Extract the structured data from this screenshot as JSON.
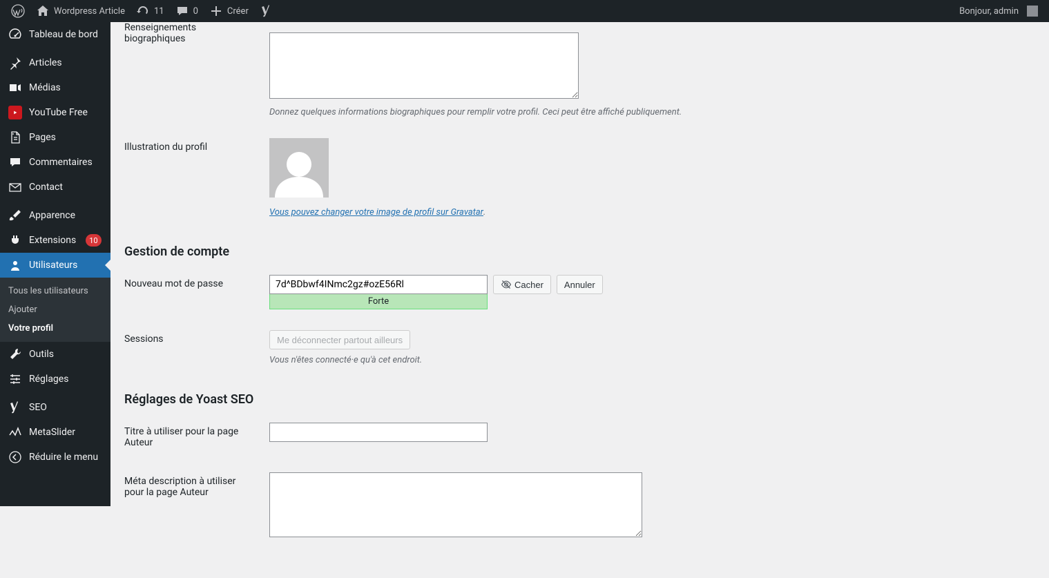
{
  "adminbar": {
    "site_name": "Wordpress Article",
    "updates": "11",
    "comments": "0",
    "new": "Créer",
    "greeting": "Bonjour, admin"
  },
  "menu": {
    "dashboard": "Tableau de bord",
    "posts": "Articles",
    "media": "Médias",
    "youtube": "YouTube Free",
    "pages": "Pages",
    "comments": "Commentaires",
    "contact": "Contact",
    "appearance": "Apparence",
    "plugins": "Extensions",
    "plugins_badge": "10",
    "users": "Utilisateurs",
    "users_sub": {
      "all": "Tous les utilisateurs",
      "add": "Ajouter",
      "profile": "Votre profil"
    },
    "tools": "Outils",
    "settings": "Réglages",
    "seo": "SEO",
    "metaslider": "MetaSlider",
    "collapse": "Réduire le menu"
  },
  "profile": {
    "bio_label": "Renseignements biographiques",
    "bio_desc": "Donnez quelques informations biographiques pour remplir votre profil. Ceci peut être affiché publiquement.",
    "avatar_label": "Illustration du profil",
    "gravatar_link": "Vous pouvez changer votre image de profil sur Gravatar",
    "account_heading": "Gestion de compte",
    "new_pw_label": "Nouveau mot de passe",
    "pw_value": "7d^BDbwf4INmc2gz#ozE56Rl",
    "pw_strength": "Forte",
    "hide_btn": "Cacher",
    "cancel_btn": "Annuler",
    "sessions_label": "Sessions",
    "logout_elsewhere": "Me déconnecter partout ailleurs",
    "sessions_desc": "Vous n'êtes connecté·e qu'à cet endroit.",
    "yoast_heading": "Réglages de Yoast SEO",
    "author_title_label": "Titre à utiliser pour la page Auteur",
    "author_meta_label": "Méta description à utiliser pour la page Auteur"
  }
}
